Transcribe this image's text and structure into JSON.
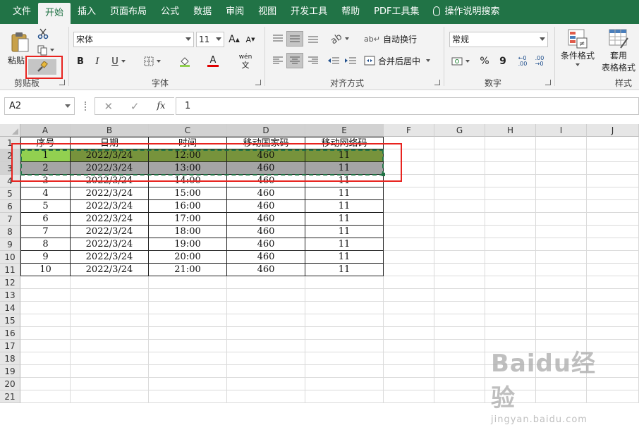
{
  "menu": {
    "items": [
      "文件",
      "开始",
      "插入",
      "页面布局",
      "公式",
      "数据",
      "审阅",
      "视图",
      "开发工具",
      "帮助",
      "PDF工具集"
    ],
    "active": "开始",
    "tell_me": "操作说明搜索"
  },
  "ribbon": {
    "clipboard": {
      "paste": "粘贴",
      "label": "剪贴板"
    },
    "font": {
      "name": "宋体",
      "size": "11",
      "bold": "B",
      "italic": "I",
      "underline": "U",
      "grow": "A",
      "shrink": "A",
      "font_color": "A",
      "phonetic_top": "wén",
      "phonetic_bottom": "文",
      "label": "字体"
    },
    "alignment": {
      "wrap": "自动换行",
      "merge": "合并后居中",
      "label": "对齐方式"
    },
    "number": {
      "format": "常规",
      "percent": "%",
      "comma": "9",
      "inc_decimal": "←0\n.00",
      "label": "数字"
    },
    "styles": {
      "conditional": "条件格式",
      "table_format_1": "套用",
      "table_format_2": "表格格式",
      "label": "样式"
    }
  },
  "formula_bar": {
    "name_box": "A2",
    "fx": "fx",
    "value": "1"
  },
  "sheet": {
    "columns": [
      "A",
      "B",
      "C",
      "D",
      "E",
      "F",
      "G",
      "H",
      "I",
      "J"
    ],
    "row_numbers": [
      "1",
      "2",
      "3",
      "4",
      "5",
      "6",
      "7",
      "8",
      "9",
      "10",
      "11",
      "12",
      "13",
      "14",
      "15",
      "16",
      "17",
      "18",
      "19",
      "20",
      "21"
    ],
    "header_row": [
      "序号",
      "日期",
      "时间",
      "移动国家码",
      "移动网络码"
    ],
    "data_rows": [
      [
        "1",
        "2022/3/24",
        "12:00",
        "460",
        "11"
      ],
      [
        "2",
        "2022/3/24",
        "13:00",
        "460",
        "11"
      ],
      [
        "3",
        "2022/3/24",
        "14:00",
        "460",
        "11"
      ],
      [
        "4",
        "2022/3/24",
        "15:00",
        "460",
        "11"
      ],
      [
        "5",
        "2022/3/24",
        "16:00",
        "460",
        "11"
      ],
      [
        "6",
        "2022/3/24",
        "17:00",
        "460",
        "11"
      ],
      [
        "7",
        "2022/3/24",
        "18:00",
        "460",
        "11"
      ],
      [
        "8",
        "2022/3/24",
        "19:00",
        "460",
        "11"
      ],
      [
        "9",
        "2022/3/24",
        "20:00",
        "460",
        "11"
      ],
      [
        "10",
        "2022/3/24",
        "21:00",
        "460",
        "11"
      ]
    ]
  },
  "watermark": {
    "big": "Baidu经验",
    "small": "jingyan.baidu.com"
  },
  "colors": {
    "excel_green": "#217346",
    "row2_fill": "#77933c",
    "a2_fill": "#92d050",
    "row3_fill": "#a5a5a5",
    "annotation_red": "#e8231f"
  }
}
